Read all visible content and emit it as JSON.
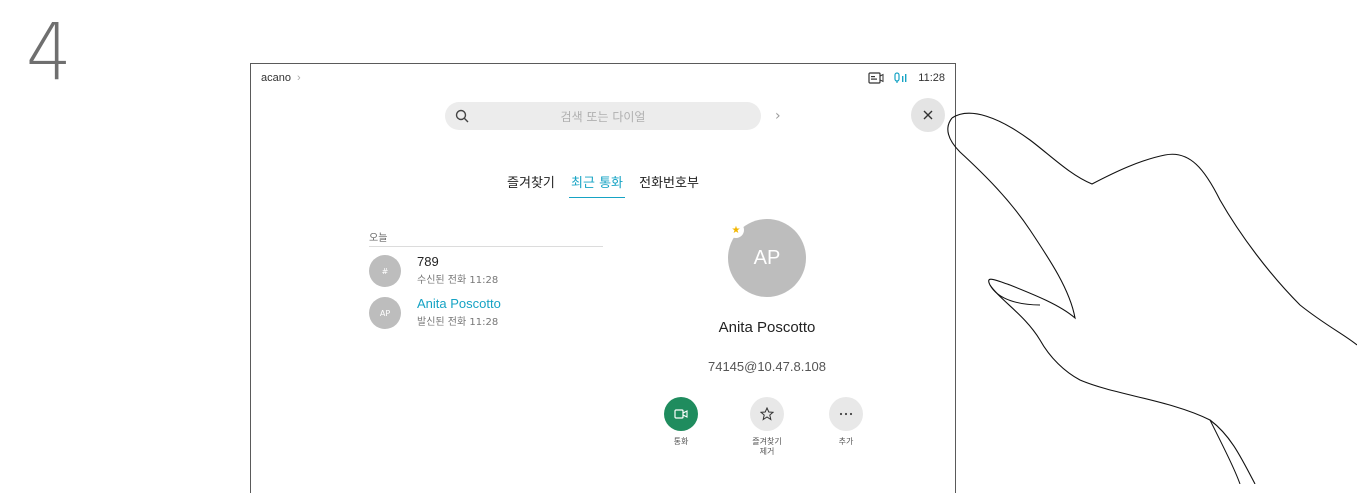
{
  "step": {
    "number": "4"
  },
  "header": {
    "title": "acano",
    "chevron": "›",
    "time": "11:28"
  },
  "search": {
    "placeholder": "검색 또는 다이얼",
    "arrow": "›"
  },
  "tabs": [
    {
      "label": "즐겨찾기",
      "active": false
    },
    {
      "label": "최근 통화",
      "active": true
    },
    {
      "label": "전화번호부",
      "active": false
    }
  ],
  "recents": {
    "section_title": "오늘",
    "items": [
      {
        "avatar": "#",
        "name": "789",
        "detail": "수신된 전화 11:28"
      },
      {
        "avatar": "AP",
        "name": "Anita Poscotto",
        "detail": "발신된 전화 11:28"
      }
    ]
  },
  "contact": {
    "initials": "AP",
    "name": "Anita Poscotto",
    "address": "74145@10.47.8.108",
    "favorite_icon": "star-icon"
  },
  "actions": [
    {
      "label": "통화",
      "icon": "video-icon",
      "color": "#1f8c5e"
    },
    {
      "label": "즐겨찾기\n제거",
      "label_line1": "즐겨찾기",
      "label_line2": "제거",
      "icon": "star-outline-icon",
      "color": "#e8e8e8"
    },
    {
      "label": "추가",
      "icon": "more-icon",
      "color": "#e8e8e8"
    }
  ],
  "colors": {
    "accent": "#16a3c4",
    "call_green": "#1f8c5e",
    "avatar_gray": "#bdbdbd",
    "favorite_yellow": "#f2b600"
  }
}
